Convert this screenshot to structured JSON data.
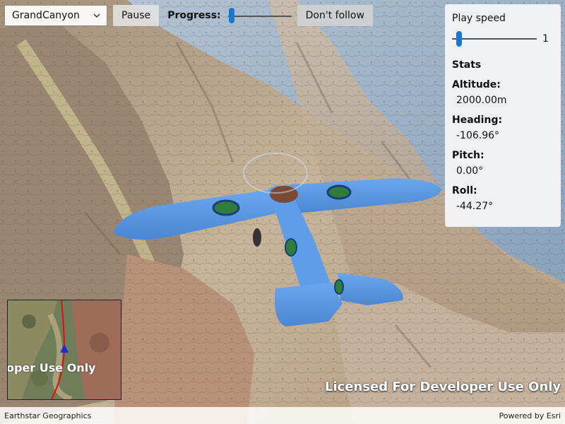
{
  "toolbar": {
    "mission_selected": "GrandCanyon",
    "pause_label": "Pause",
    "progress_label": "Progress:",
    "progress_value": 0.04,
    "follow_label": "Don't follow"
  },
  "panel": {
    "play_speed_label": "Play speed",
    "play_speed_value": "1",
    "stats_title": "Stats",
    "altitude_label": "Altitude:",
    "altitude_value": "2000.00m",
    "heading_label": "Heading:",
    "heading_value": "-106.96°",
    "pitch_label": "Pitch:",
    "pitch_value": "0.00°",
    "roll_label": "Roll:",
    "roll_value": "-44.27°"
  },
  "minimap": {
    "watermark_text": "oper Use Only"
  },
  "scene": {
    "watermark_text": "Licensed For Developer Use Only"
  },
  "attribution": {
    "left": "Earthstar Geographics",
    "right": "Powered by Esri"
  },
  "colors": {
    "accent": "#1976d2",
    "plane": "#5b9be6",
    "sky": "#9bb6cf",
    "terrain": "#c9b49a",
    "route": "#e01010"
  },
  "icons": {
    "combo": "chevron-down-icon",
    "plane": "airplane-model",
    "minimap_marker": "location-triangle-icon"
  }
}
